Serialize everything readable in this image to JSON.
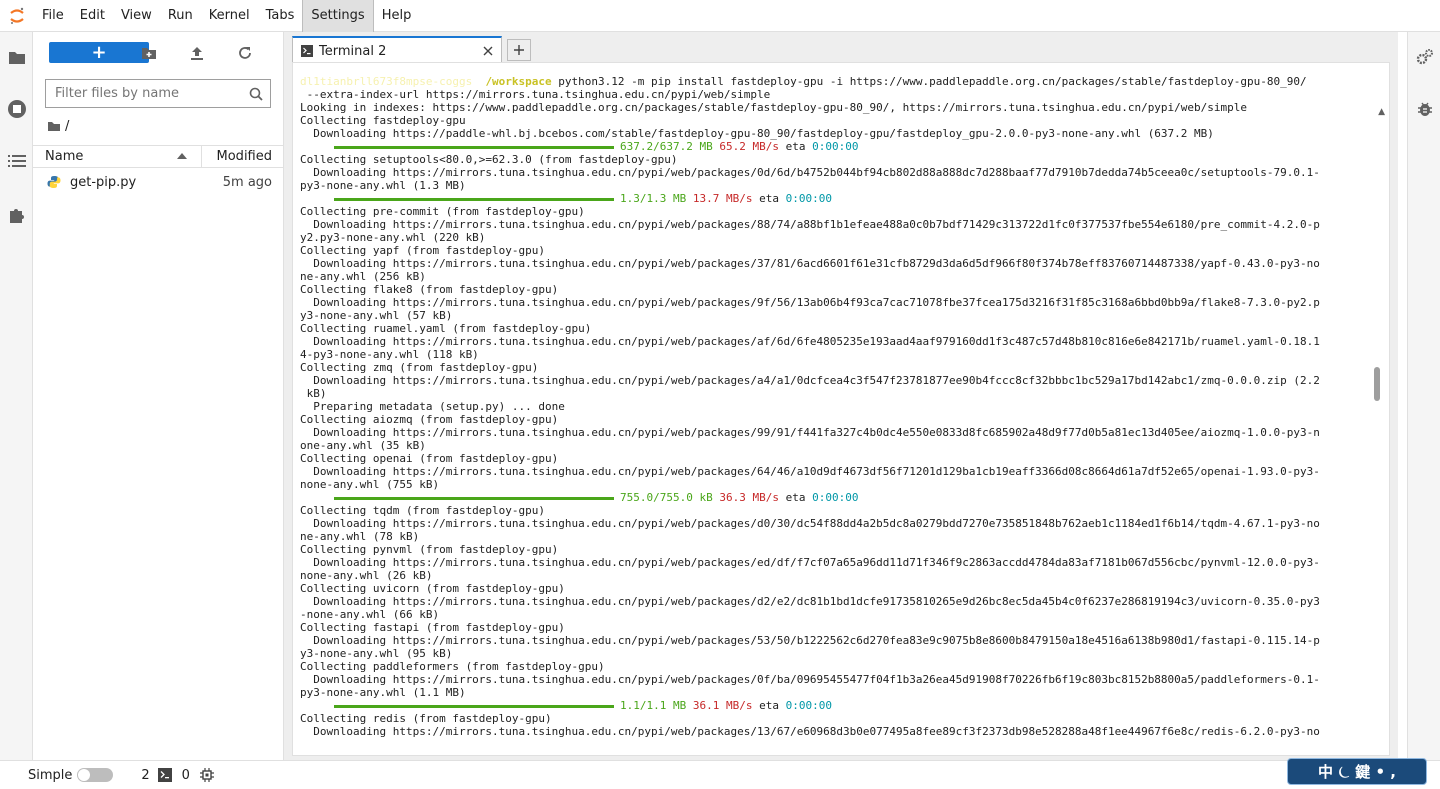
{
  "menubar": {
    "items": [
      "File",
      "Edit",
      "View",
      "Run",
      "Kernel",
      "Tabs",
      "Settings",
      "Help"
    ],
    "active": "Settings"
  },
  "filebrowser": {
    "new_label": "+",
    "search_placeholder": "Filter files by name",
    "breadcrumb": "/",
    "header": {
      "name": "Name",
      "modified": "Modified"
    },
    "files": [
      {
        "name": "get-pip.py",
        "modified": "5m ago"
      }
    ]
  },
  "tabs": [
    {
      "label": "Terminal 2"
    }
  ],
  "terminal": {
    "prompt_user": "dl1tianbrll673f8mpse-coggs",
    "prompt_path": "/workspace",
    "lines": [
      {
        "t": "python3.12 -m pip install fastdeploy-gpu -i https://www.paddlepaddle.org.cn/packages/stable/fastdeploy-gpu-80_90/",
        "kind": "cmd"
      },
      {
        "t": " --extra-index-url https://mirrors.tuna.tsinghua.edu.cn/pypi/web/simple"
      },
      {
        "t": "Looking in indexes: https://www.paddlepaddle.org.cn/packages/stable/fastdeploy-gpu-80_90/, https://mirrors.tuna.tsinghua.edu.cn/pypi/web/simple"
      },
      {
        "t": "Collecting fastdeploy-gpu"
      },
      {
        "t": "  Downloading https://paddle-whl.bj.bcebos.com/stable/fastdeploy-gpu-80_90/fastdeploy-gpu/fastdeploy_gpu-2.0.0-py3-none-any.whl (637.2 MB)"
      },
      {
        "kind": "progress",
        "size": "637.2/637.2 MB",
        "speed": "65.2 MB/s",
        "eta": "0:00:00"
      },
      {
        "t": "Collecting setuptools<80.0,>=62.3.0 (from fastdeploy-gpu)"
      },
      {
        "t": "  Downloading https://mirrors.tuna.tsinghua.edu.cn/pypi/web/packages/0d/6d/b4752b044bf94cb802d88a888dc7d288baaf77d7910b7dedda74b5ceea0c/setuptools-79.0.1-"
      },
      {
        "t": "py3-none-any.whl (1.3 MB)"
      },
      {
        "kind": "progress",
        "size": "1.3/1.3 MB",
        "speed": "13.7 MB/s",
        "eta": "0:00:00"
      },
      {
        "t": "Collecting pre-commit (from fastdeploy-gpu)"
      },
      {
        "t": "  Downloading https://mirrors.tuna.tsinghua.edu.cn/pypi/web/packages/88/74/a88bf1b1efeae488a0c0b7bdf71429c313722d1fc0f377537fbe554e6180/pre_commit-4.2.0-p"
      },
      {
        "t": "y2.py3-none-any.whl (220 kB)"
      },
      {
        "t": "Collecting yapf (from fastdeploy-gpu)"
      },
      {
        "t": "  Downloading https://mirrors.tuna.tsinghua.edu.cn/pypi/web/packages/37/81/6acd6601f61e31cfb8729d3da6d5df966f80f374b78eff83760714487338/yapf-0.43.0-py3-no"
      },
      {
        "t": "ne-any.whl (256 kB)"
      },
      {
        "t": "Collecting flake8 (from fastdeploy-gpu)"
      },
      {
        "t": "  Downloading https://mirrors.tuna.tsinghua.edu.cn/pypi/web/packages/9f/56/13ab06b4f93ca7cac71078fbe37fcea175d3216f31f85c3168a6bbd0bb9a/flake8-7.3.0-py2.p"
      },
      {
        "t": "y3-none-any.whl (57 kB)"
      },
      {
        "t": "Collecting ruamel.yaml (from fastdeploy-gpu)"
      },
      {
        "t": "  Downloading https://mirrors.tuna.tsinghua.edu.cn/pypi/web/packages/af/6d/6fe4805235e193aad4aaf979160dd1f3c487c57d48b810c816e6e842171b/ruamel.yaml-0.18.1"
      },
      {
        "t": "4-py3-none-any.whl (118 kB)"
      },
      {
        "t": "Collecting zmq (from fastdeploy-gpu)"
      },
      {
        "t": "  Downloading https://mirrors.tuna.tsinghua.edu.cn/pypi/web/packages/a4/a1/0dcfcea4c3f547f23781877ee90b4fccc8cf32bbbc1bc529a17bd142abc1/zmq-0.0.0.zip (2.2"
      },
      {
        "t": " kB)"
      },
      {
        "t": "  Preparing metadata (setup.py) ... done"
      },
      {
        "t": "Collecting aiozmq (from fastdeploy-gpu)"
      },
      {
        "t": "  Downloading https://mirrors.tuna.tsinghua.edu.cn/pypi/web/packages/99/91/f441fa327c4b0dc4e550e0833d8fc685902a48d9f77d0b5a81ec13d405ee/aiozmq-1.0.0-py3-n"
      },
      {
        "t": "one-any.whl (35 kB)"
      },
      {
        "t": "Collecting openai (from fastdeploy-gpu)"
      },
      {
        "t": "  Downloading https://mirrors.tuna.tsinghua.edu.cn/pypi/web/packages/64/46/a10d9df4673df56f71201d129ba1cb19eaff3366d08c8664d61a7df52e65/openai-1.93.0-py3-"
      },
      {
        "t": "none-any.whl (755 kB)"
      },
      {
        "kind": "progress",
        "size": "755.0/755.0 kB",
        "speed": "36.3 MB/s",
        "eta": "0:00:00"
      },
      {
        "t": "Collecting tqdm (from fastdeploy-gpu)"
      },
      {
        "t": "  Downloading https://mirrors.tuna.tsinghua.edu.cn/pypi/web/packages/d0/30/dc54f88dd4a2b5dc8a0279bdd7270e735851848b762aeb1c1184ed1f6b14/tqdm-4.67.1-py3-no"
      },
      {
        "t": "ne-any.whl (78 kB)"
      },
      {
        "t": "Collecting pynvml (from fastdeploy-gpu)"
      },
      {
        "t": "  Downloading https://mirrors.tuna.tsinghua.edu.cn/pypi/web/packages/ed/df/f7cf07a65a96dd11d71f346f9c2863accdd4784da83af7181b067d556cbc/pynvml-12.0.0-py3-"
      },
      {
        "t": "none-any.whl (26 kB)"
      },
      {
        "t": "Collecting uvicorn (from fastdeploy-gpu)"
      },
      {
        "t": "  Downloading https://mirrors.tuna.tsinghua.edu.cn/pypi/web/packages/d2/e2/dc81b1bd1dcfe91735810265e9d26bc8ec5da45b4c0f6237e286819194c3/uvicorn-0.35.0-py3"
      },
      {
        "t": "-none-any.whl (66 kB)"
      },
      {
        "t": "Collecting fastapi (from fastdeploy-gpu)"
      },
      {
        "t": "  Downloading https://mirrors.tuna.tsinghua.edu.cn/pypi/web/packages/53/50/b1222562c6d270fea83e9c9075b8e8600b8479150a18e4516a6138b980d1/fastapi-0.115.14-p"
      },
      {
        "t": "y3-none-any.whl (95 kB)"
      },
      {
        "t": "Collecting paddleformers (from fastdeploy-gpu)"
      },
      {
        "t": "  Downloading https://mirrors.tuna.tsinghua.edu.cn/pypi/web/packages/0f/ba/09695455477f04f1b3a26ea45d91908f70226fb6f19c803bc8152b8800a5/paddleformers-0.1-"
      },
      {
        "t": "py3-none-any.whl (1.1 MB)"
      },
      {
        "kind": "progress",
        "size": "1.1/1.1 MB",
        "speed": "36.1 MB/s",
        "eta": "0:00:00"
      },
      {
        "t": "Collecting redis (from fastdeploy-gpu)"
      },
      {
        "t": "  Downloading https://mirrors.tuna.tsinghua.edu.cn/pypi/web/packages/13/67/e60968d3b0e077495a8fee89cf3f2373db98e528288a48f1ee44967f6e8c/redis-6.2.0-py3-no"
      }
    ]
  },
  "statusbar": {
    "mode_label": "Simple",
    "kernels_count": "2",
    "terminals_count": "0"
  },
  "ime": {
    "text": "中 ⏾ 鍵 • ,"
  },
  "colors": {
    "accent": "#1976d2",
    "progress": "#4aa61a",
    "speed": "#c62828",
    "eta": "#0097a7"
  }
}
